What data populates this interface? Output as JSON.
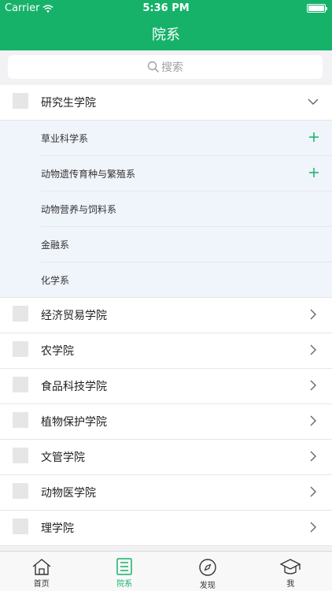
{
  "status_bar": {
    "carrier": "Carrier",
    "time": "5:36 PM"
  },
  "nav": {
    "title": "院系"
  },
  "search": {
    "placeholder": "搜索"
  },
  "colleges": [
    {
      "name": "研究生学院",
      "expanded": true,
      "departments": [
        {
          "name": "草业科学系",
          "has_children": true
        },
        {
          "name": "动物遗传育种与繁殖系",
          "has_children": true
        },
        {
          "name": "动物营养与饲料系",
          "has_children": false
        },
        {
          "name": "金融系",
          "has_children": false
        },
        {
          "name": "化学系",
          "has_children": false
        }
      ]
    },
    {
      "name": "经济贸易学院",
      "expanded": false
    },
    {
      "name": "农学院",
      "expanded": false
    },
    {
      "name": "食品科技学院",
      "expanded": false
    },
    {
      "name": "植物保护学院",
      "expanded": false
    },
    {
      "name": "文管学院",
      "expanded": false
    },
    {
      "name": "动物医学院",
      "expanded": false
    },
    {
      "name": "理学院",
      "expanded": false
    }
  ],
  "tabs": [
    {
      "label": "首页",
      "icon": "home-icon",
      "active": false
    },
    {
      "label": "院系",
      "icon": "list-icon",
      "active": true
    },
    {
      "label": "发现",
      "icon": "compass-icon",
      "active": false
    },
    {
      "label": "我",
      "icon": "graduation-cap-icon",
      "active": false
    }
  ],
  "colors": {
    "brand": "#16b26a",
    "expanded_bg": "#f0f4fb",
    "accent_plus": "#16b26a"
  }
}
